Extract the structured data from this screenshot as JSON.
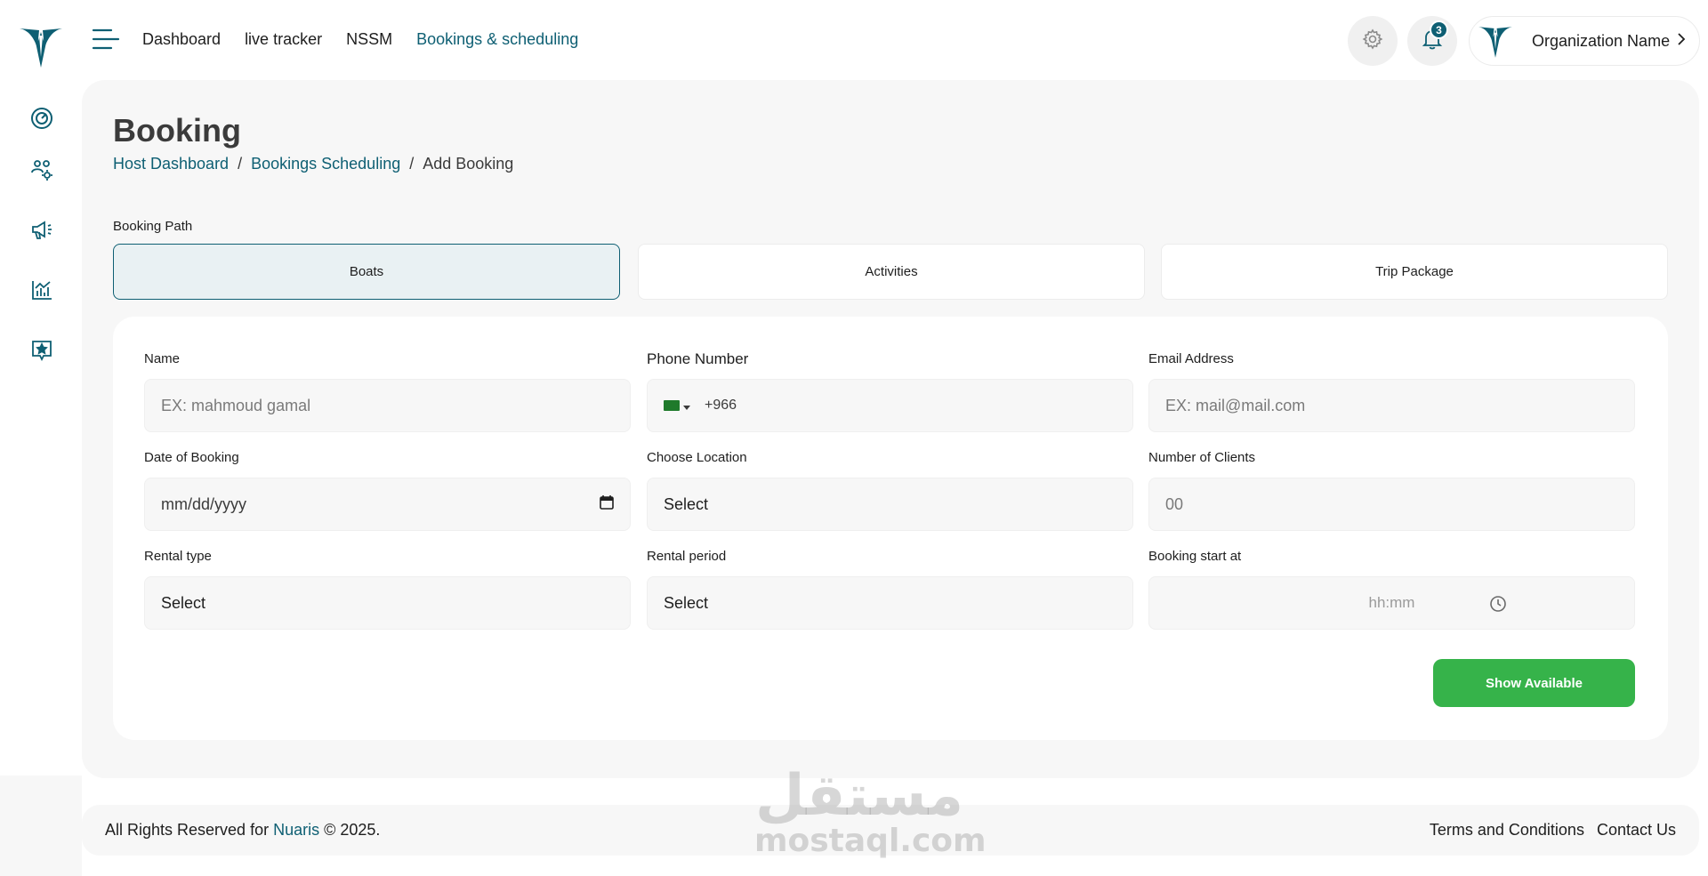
{
  "nav": {
    "menu_items": [
      "Dashboard",
      "live tracker",
      "NSSM",
      "Bookings & scheduling"
    ],
    "active_index": 3
  },
  "sidebar": {
    "icons": [
      "gauge-icon",
      "team-settings-icon",
      "megaphone-icon",
      "analytics-chart-icon",
      "star-badge-icon"
    ]
  },
  "topbar": {
    "settings_icon": "gear-icon",
    "notifications_icon": "bell-icon",
    "notification_count": "3",
    "org_name": "Organization Name"
  },
  "page": {
    "title": "Booking",
    "breadcrumb": [
      "Host Dashboard",
      "Bookings Scheduling",
      "Add Booking"
    ],
    "separator": "/"
  },
  "booking_path": {
    "label": "Booking Path",
    "options": [
      "Boats",
      "Activities",
      "Trip Package"
    ],
    "selected": "Boats"
  },
  "form": {
    "name": {
      "label": "Name",
      "placeholder": "EX: mahmoud gamal"
    },
    "phone": {
      "label": "Phone Number",
      "dial_code": "+966",
      "flag": "saudi-arabia-flag"
    },
    "email": {
      "label": "Email Address",
      "placeholder": "EX: mail@mail.com"
    },
    "date": {
      "label": "Date of Booking",
      "placeholder": "mm/dd/yyyy"
    },
    "location": {
      "label": "Choose Location",
      "value": "Select"
    },
    "clients": {
      "label": "Number of Clients",
      "placeholder": "00"
    },
    "rental_type": {
      "label": "Rental type",
      "value": "Select"
    },
    "rental_period": {
      "label": "Rental period",
      "value": "Select"
    },
    "start_at": {
      "label": "Booking start at",
      "placeholder": "hh:mm"
    },
    "submit_label": "Show Available"
  },
  "footer": {
    "copyright_prefix": "All Rights Reserved for ",
    "brand": "Nuaris",
    "copyright_suffix": " © 2025.",
    "links": [
      "Terms and Conditions",
      "Contact Us"
    ]
  },
  "watermark": {
    "arabic": "مستقل",
    "latin": "mostaql.com"
  },
  "colors": {
    "primary": "#0e5f73",
    "accent_green": "#36b34a",
    "panel_bg": "#f7f7f7"
  }
}
